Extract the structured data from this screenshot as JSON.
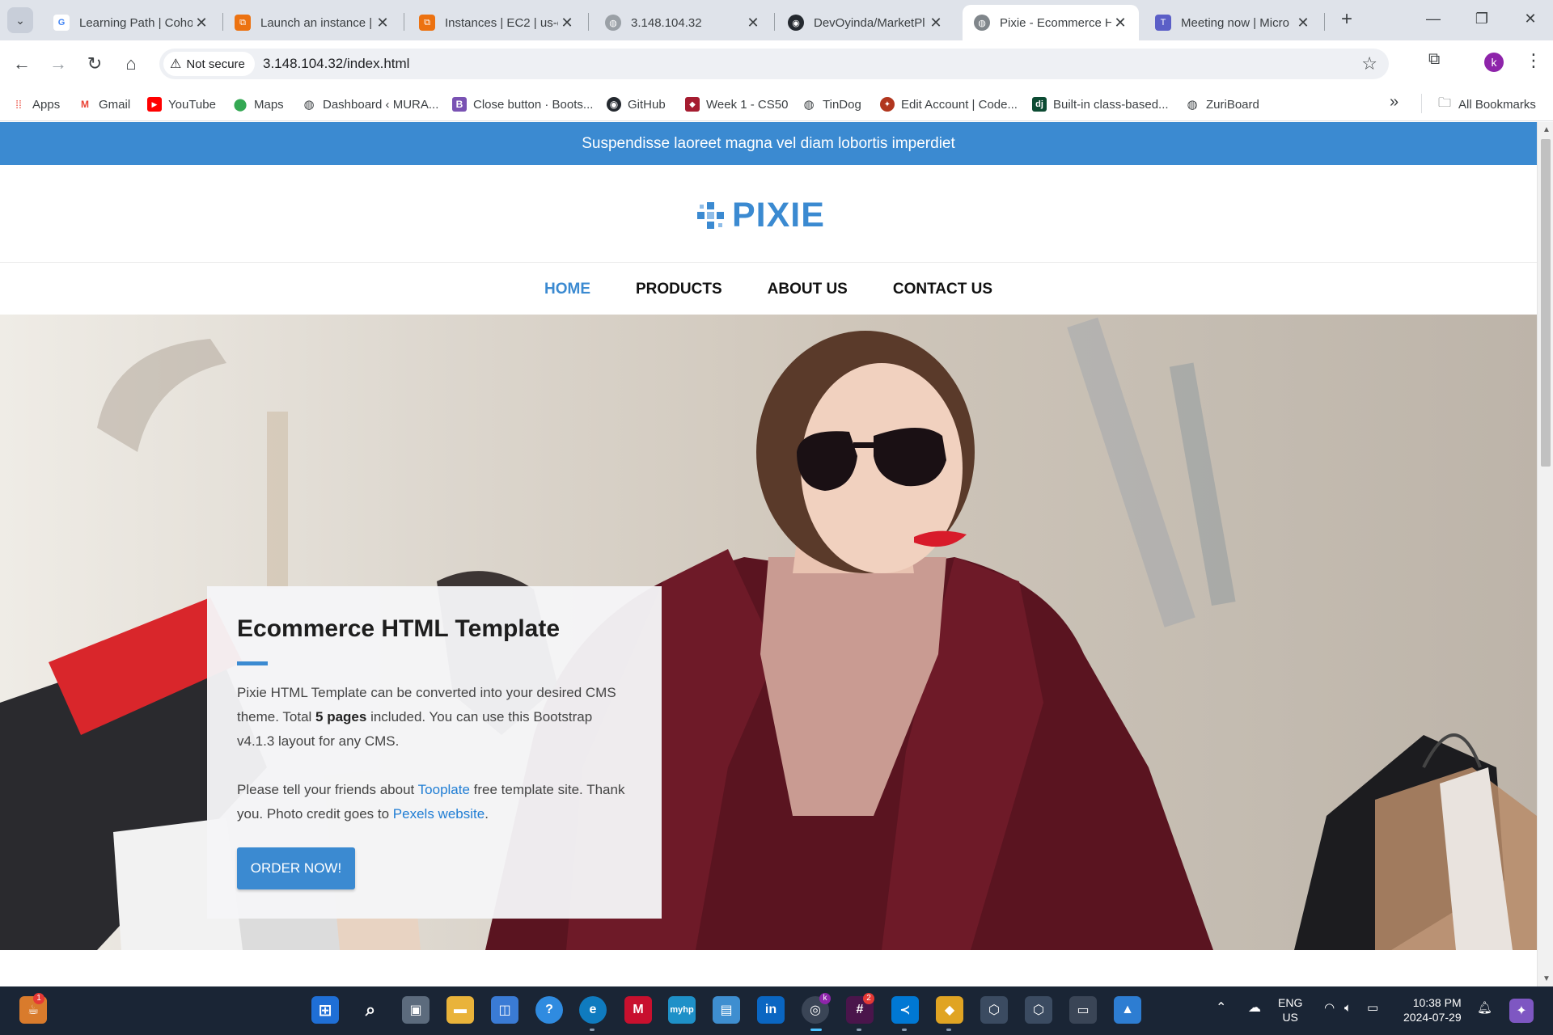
{
  "browser": {
    "tabs": [
      {
        "title": "Learning Path | Coho",
        "active": false
      },
      {
        "title": "Launch an instance |",
        "active": false
      },
      {
        "title": "Instances | EC2 | us-e",
        "active": false
      },
      {
        "title": "3.148.104.32",
        "active": false
      },
      {
        "title": "DevOyinda/MarketPl",
        "active": false
      },
      {
        "title": "Pixie - Ecommerce H",
        "active": true
      },
      {
        "title": "Meeting now | Micro",
        "active": false
      }
    ],
    "not_secure_label": "Not secure",
    "url": "3.148.104.32/index.html",
    "profile_initial": "k",
    "bookmarks": [
      {
        "label": "Apps",
        "icon": "apps-grid-icon"
      },
      {
        "label": "Gmail",
        "icon": "gmail-icon"
      },
      {
        "label": "YouTube",
        "icon": "youtube-icon"
      },
      {
        "label": "Maps",
        "icon": "maps-icon"
      },
      {
        "label": "Dashboard ‹ MURA...",
        "icon": "globe-icon"
      },
      {
        "label": "Close button · Boots...",
        "icon": "bootstrap-icon"
      },
      {
        "label": "GitHub",
        "icon": "github-icon"
      },
      {
        "label": "Week 1 - CS50",
        "icon": "harvard-icon"
      },
      {
        "label": "TinDog",
        "icon": "globe-icon"
      },
      {
        "label": "Edit Account | Code...",
        "icon": "codewars-icon"
      },
      {
        "label": "Built-in class-based...",
        "icon": "django-icon"
      },
      {
        "label": "ZuriBoard",
        "icon": "globe-icon"
      }
    ],
    "all_bookmarks_label": "All Bookmarks"
  },
  "page": {
    "announcement": "Suspendisse laoreet magna vel diam lobortis imperdiet",
    "logo_text": "PIXIE",
    "nav": [
      {
        "label": "HOME",
        "active": true
      },
      {
        "label": "PRODUCTS",
        "active": false
      },
      {
        "label": "ABOUT US",
        "active": false
      },
      {
        "label": "CONTACT US",
        "active": false
      }
    ],
    "hero": {
      "title": "Ecommerce HTML Template",
      "p1_a": "Pixie HTML Template can be converted into your desired CMS theme. Total ",
      "p1_bold": "5 pages",
      "p1_b": " included. You can use this Bootstrap v4.1.3 layout for any CMS.",
      "p2_a": "Please tell your friends about ",
      "p2_link1": "Tooplate",
      "p2_b": " free template site. Thank you. Photo credit goes to ",
      "p2_link2": "Pexels website",
      "p2_c": ".",
      "button": "ORDER NOW!"
    },
    "brand_color": "#3b8ad1"
  },
  "taskbar": {
    "language": "ENG",
    "region": "US",
    "time": "10:38 PM",
    "date": "2024-07-29",
    "weather_badge": "1",
    "slack_badge": "2",
    "chrome_profile": "k"
  }
}
